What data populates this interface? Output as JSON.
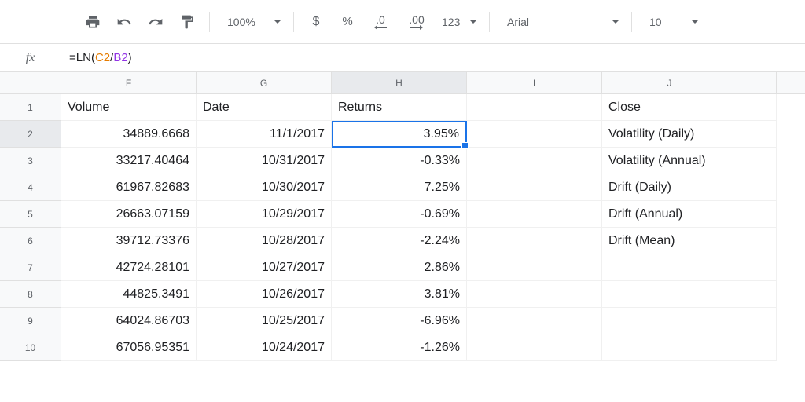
{
  "toolbar": {
    "zoom": "100%",
    "currency": "$",
    "percent": "%",
    "dec_dec": ".0",
    "inc_dec": ".00",
    "number_format": "123",
    "font": "Arial",
    "font_size": "10"
  },
  "formula": {
    "fx": "fx",
    "eq": "=",
    "fn": "LN",
    "lp": "(",
    "ref1": "C2",
    "op": "/",
    "ref2": "B2",
    "rp": ")"
  },
  "columns": [
    "F",
    "G",
    "H",
    "I",
    "J"
  ],
  "headers": {
    "F": "Volume",
    "G": "Date",
    "H": "Returns",
    "I": "",
    "J": "Close"
  },
  "rows": [
    {
      "n": "2",
      "F": "34889.6668",
      "G": "11/1/2017",
      "H": "3.95%",
      "I": "",
      "J": "Volatility (Daily)"
    },
    {
      "n": "3",
      "F": "33217.40464",
      "G": "10/31/2017",
      "H": "-0.33%",
      "I": "",
      "J": "Volatility (Annual)"
    },
    {
      "n": "4",
      "F": "61967.82683",
      "G": "10/30/2017",
      "H": "7.25%",
      "I": "",
      "J": "Drift (Daily)"
    },
    {
      "n": "5",
      "F": "26663.07159",
      "G": "10/29/2017",
      "H": "-0.69%",
      "I": "",
      "J": "Drift (Annual)"
    },
    {
      "n": "6",
      "F": "39712.73376",
      "G": "10/28/2017",
      "H": "-2.24%",
      "I": "",
      "J": "Drift (Mean)"
    },
    {
      "n": "7",
      "F": "42724.28101",
      "G": "10/27/2017",
      "H": "2.86%",
      "I": "",
      "J": ""
    },
    {
      "n": "8",
      "F": "44825.3491",
      "G": "10/26/2017",
      "H": "3.81%",
      "I": "",
      "J": ""
    },
    {
      "n": "9",
      "F": "64024.86703",
      "G": "10/25/2017",
      "H": "-6.96%",
      "I": "",
      "J": ""
    },
    {
      "n": "10",
      "F": "67056.95351",
      "G": "10/24/2017",
      "H": "-1.26%",
      "I": "",
      "J": ""
    }
  ],
  "selected": {
    "row": "2",
    "col": "H"
  }
}
